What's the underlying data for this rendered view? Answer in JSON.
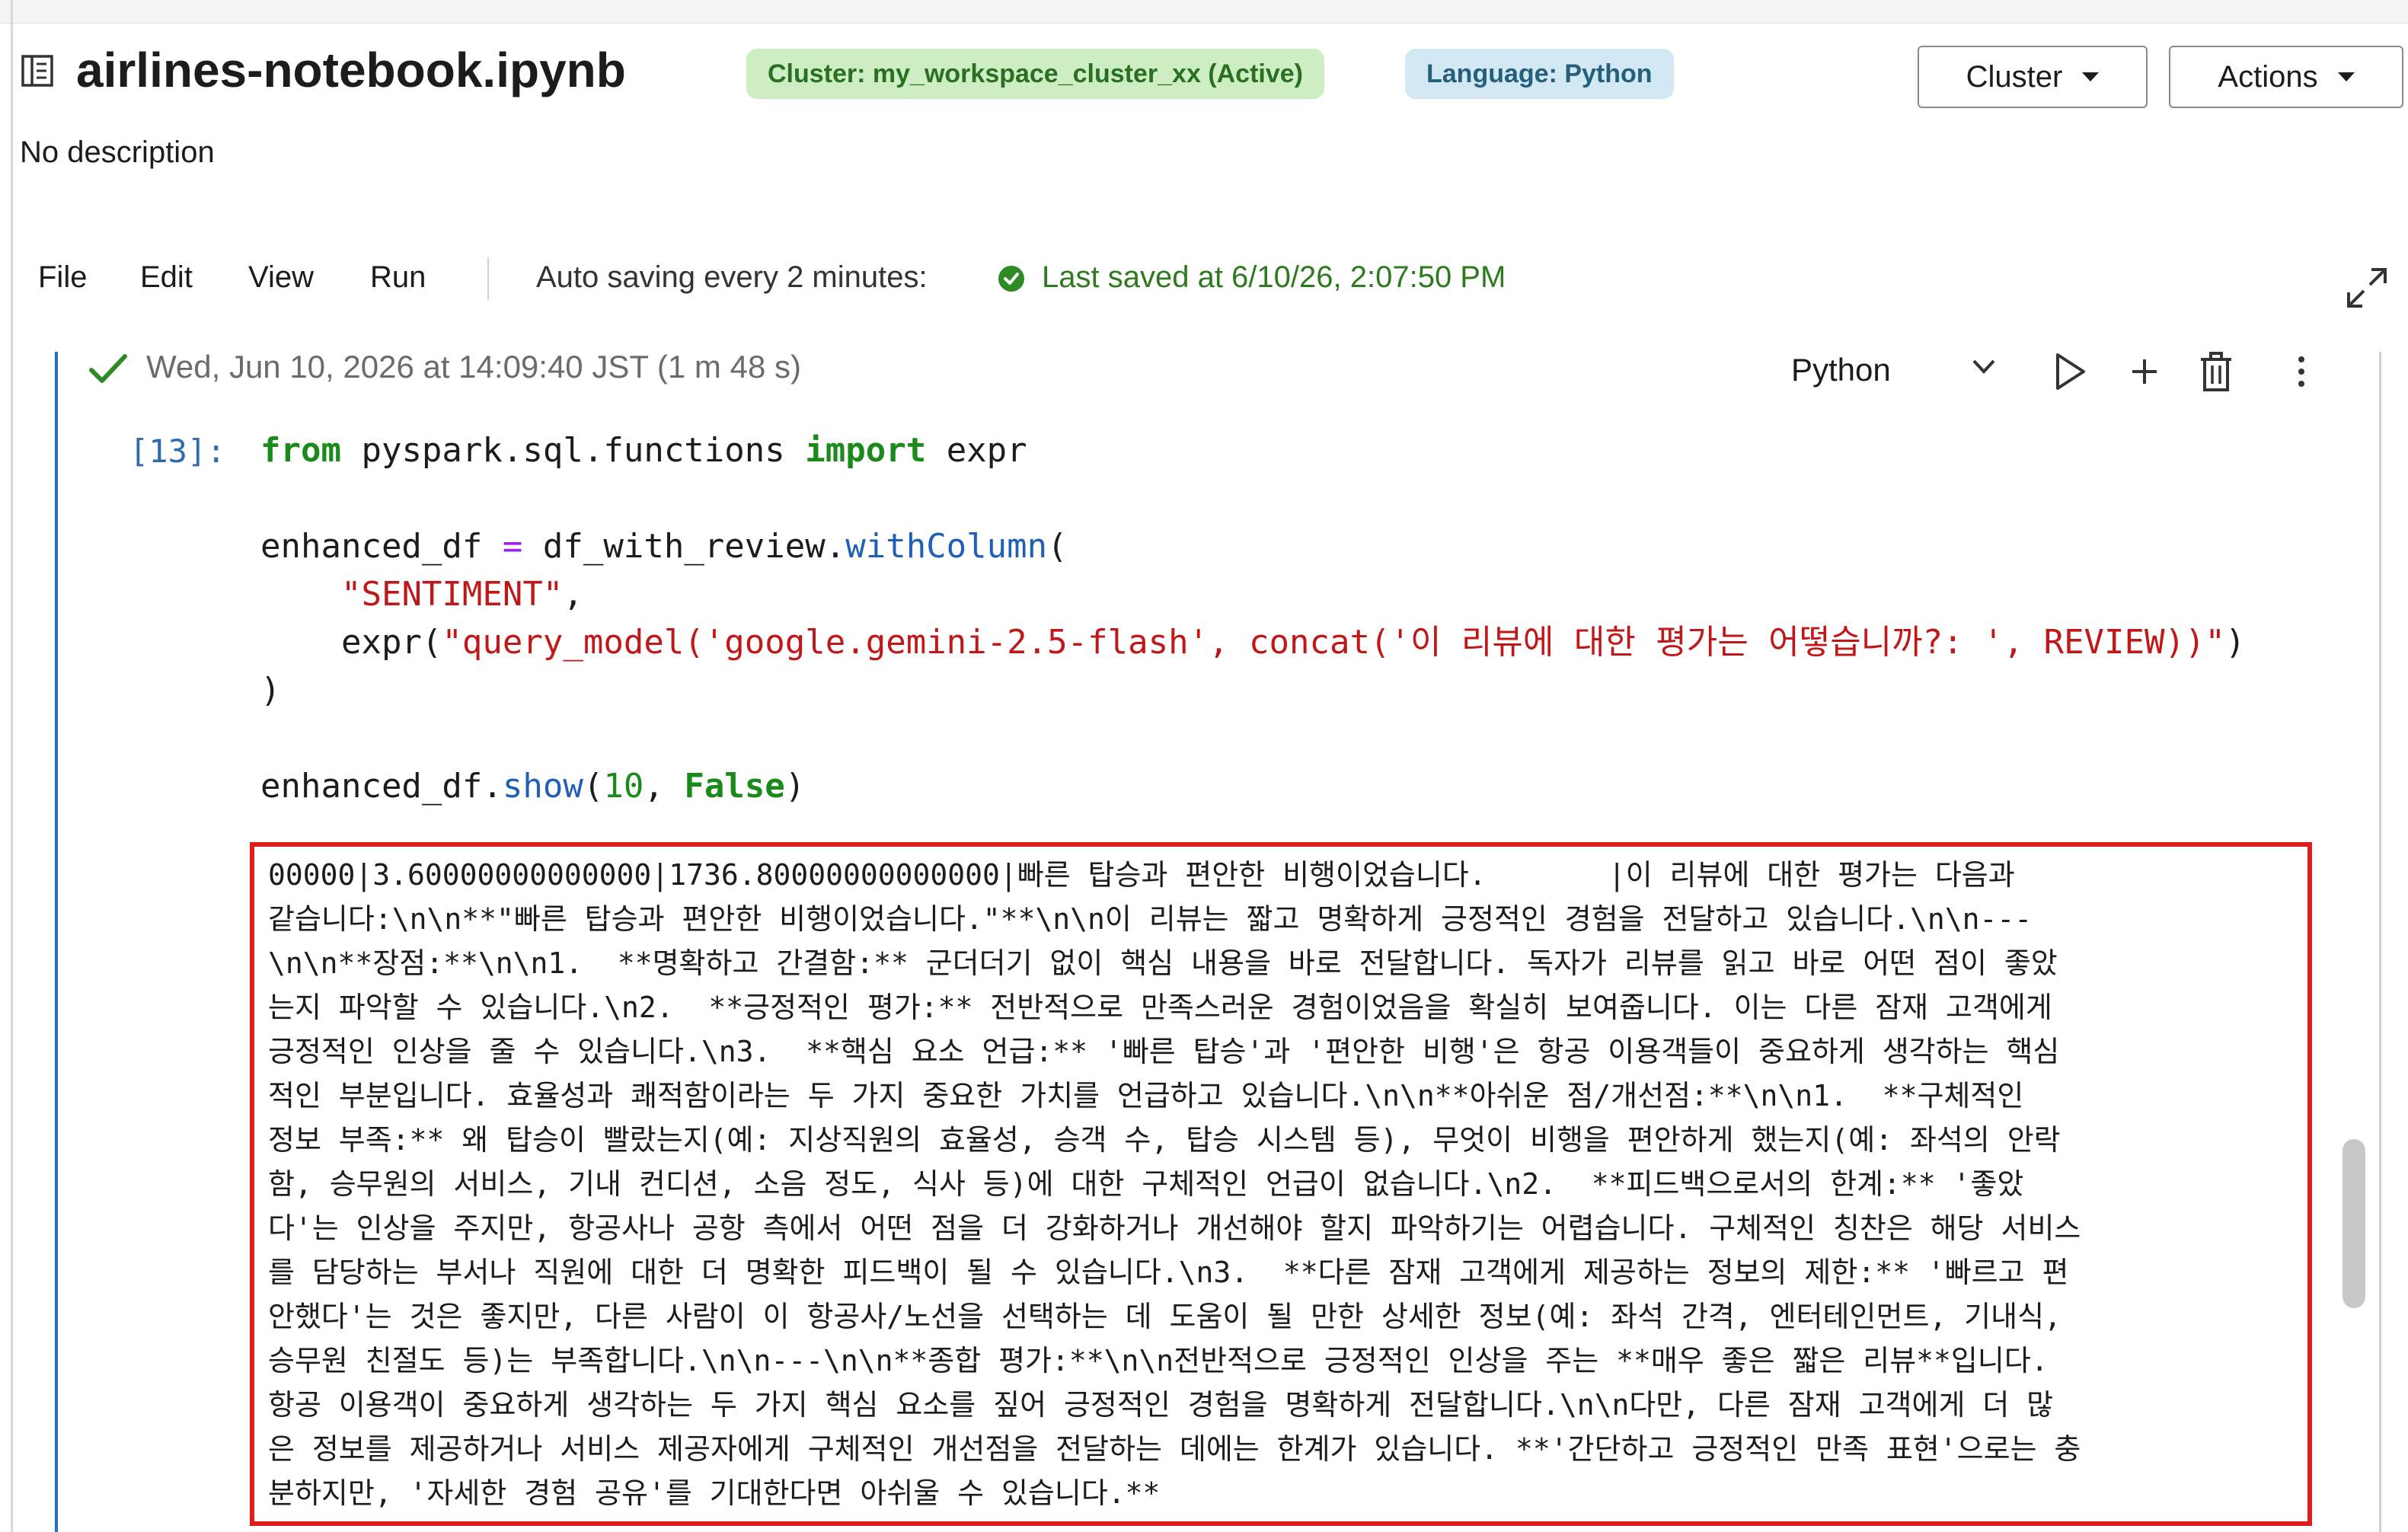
{
  "notebook": {
    "title": "airlines-notebook.ipynb",
    "description": "No description",
    "cluster_badge": "Cluster: my_workspace_cluster_xx (Active)",
    "language_badge": "Language: Python",
    "buttons": {
      "cluster": "Cluster",
      "actions": "Actions"
    }
  },
  "toolbar": {
    "menu": [
      "File",
      "Edit",
      "View",
      "Run"
    ],
    "autosave": "Auto saving every 2 minutes:",
    "last_saved": "Last saved at 6/10/26, 2:07:50 PM"
  },
  "cell": {
    "timestamp": "Wed, Jun 10, 2026 at 14:09:40 JST (1 m 48 s)",
    "language": "Python",
    "prompt": "[13]:",
    "code": {
      "l1_kw1": "from",
      "l1_mod": " pyspark.sql.functions ",
      "l1_kw2": "import",
      "l1_name": " expr",
      "l3_var": "enhanced_df ",
      "l3_op": "=",
      "l3_obj": " df_with_review.",
      "l3_fn": "withColumn",
      "l3_paren": "(",
      "l4_indent": "    ",
      "l4_str": "\"SENTIMENT\"",
      "l4_comma": ",",
      "l5_pre": "    expr(",
      "l5_str": "\"query_model('google.gemini-2.5-flash', concat('이 리뷰에 대한 평가는 어떻습니까?: ', REVIEW))\"",
      "l5_post": ")",
      "l6": ")",
      "l8_obj": "enhanced_df.",
      "l8_fn": "show",
      "l8_open": "(",
      "l8_num": "10",
      "l8_sep": ", ",
      "l8_kw": "False",
      "l8_close": ")"
    },
    "output_lines": [
      "00000|3.60000000000000|1736.80000000000000|빠른 탑승과 편안한 비행이었습니다.       |이 리뷰에 대한 평가는 다음과",
      "같습니다:\\n\\n**\"빠른 탑승과 편안한 비행이었습니다.\"**\\n\\n이 리뷰는 짧고 명확하게 긍정적인 경험을 전달하고 있습니다.\\n\\n---",
      "\\n\\n**장점:**\\n\\n1.  **명확하고 간결함:** 군더더기 없이 핵심 내용을 바로 전달합니다. 독자가 리뷰를 읽고 바로 어떤 점이 좋았",
      "는지 파악할 수 있습니다.\\n2.  **긍정적인 평가:** 전반적으로 만족스러운 경험이었음을 확실히 보여줍니다. 이는 다른 잠재 고객에게",
      "긍정적인 인상을 줄 수 있습니다.\\n3.  **핵심 요소 언급:** '빠른 탑승'과 '편안한 비행'은 항공 이용객들이 중요하게 생각하는 핵심",
      "적인 부분입니다. 효율성과 쾌적함이라는 두 가지 중요한 가치를 언급하고 있습니다.\\n\\n**아쉬운 점/개선점:**\\n\\n1.  **구체적인",
      "정보 부족:** 왜 탑승이 빨랐는지(예: 지상직원의 효율성, 승객 수, 탑승 시스템 등), 무엇이 비행을 편안하게 했는지(예: 좌석의 안락",
      "함, 승무원의 서비스, 기내 컨디션, 소음 정도, 식사 등)에 대한 구체적인 언급이 없습니다.\\n2.  **피드백으로서의 한계:** '좋았",
      "다'는 인상을 주지만, 항공사나 공항 측에서 어떤 점을 더 강화하거나 개선해야 할지 파악하기는 어렵습니다. 구체적인 칭찬은 해당 서비스",
      "를 담당하는 부서나 직원에 대한 더 명확한 피드백이 될 수 있습니다.\\n3.  **다른 잠재 고객에게 제공하는 정보의 제한:** '빠르고 편",
      "안했다'는 것은 좋지만, 다른 사람이 이 항공사/노선을 선택하는 데 도움이 될 만한 상세한 정보(예: 좌석 간격, 엔터테인먼트, 기내식,",
      "승무원 친절도 등)는 부족합니다.\\n\\n---\\n\\n**종합 평가:**\\n\\n전반적으로 긍정적인 인상을 주는 **매우 좋은 짧은 리뷰**입니다.",
      "항공 이용객이 중요하게 생각하는 두 가지 핵심 요소를 짚어 긍정적인 경험을 명확하게 전달합니다.\\n\\n다만, 다른 잠재 고객에게 더 많",
      "은 정보를 제공하거나 서비스 제공자에게 구체적인 개선점을 전달하는 데에는 한계가 있습니다. **'간단하고 긍정적인 만족 표현'으로는 충",
      "분하지만, '자세한 경험 공유'를 기대한다면 아쉬울 수 있습니다.**"
    ]
  },
  "colors": {
    "accent_blue": "#1f6fbf",
    "success_green": "#2d7a1f",
    "output_border_red": "#e01d1d"
  },
  "icons": [
    "notebook-icon",
    "saved-check-icon",
    "expand-icon",
    "cell-success-check-icon",
    "chevron-down-icon",
    "run-icon",
    "add-cell-icon",
    "trash-icon",
    "more-vertical-icon"
  ]
}
